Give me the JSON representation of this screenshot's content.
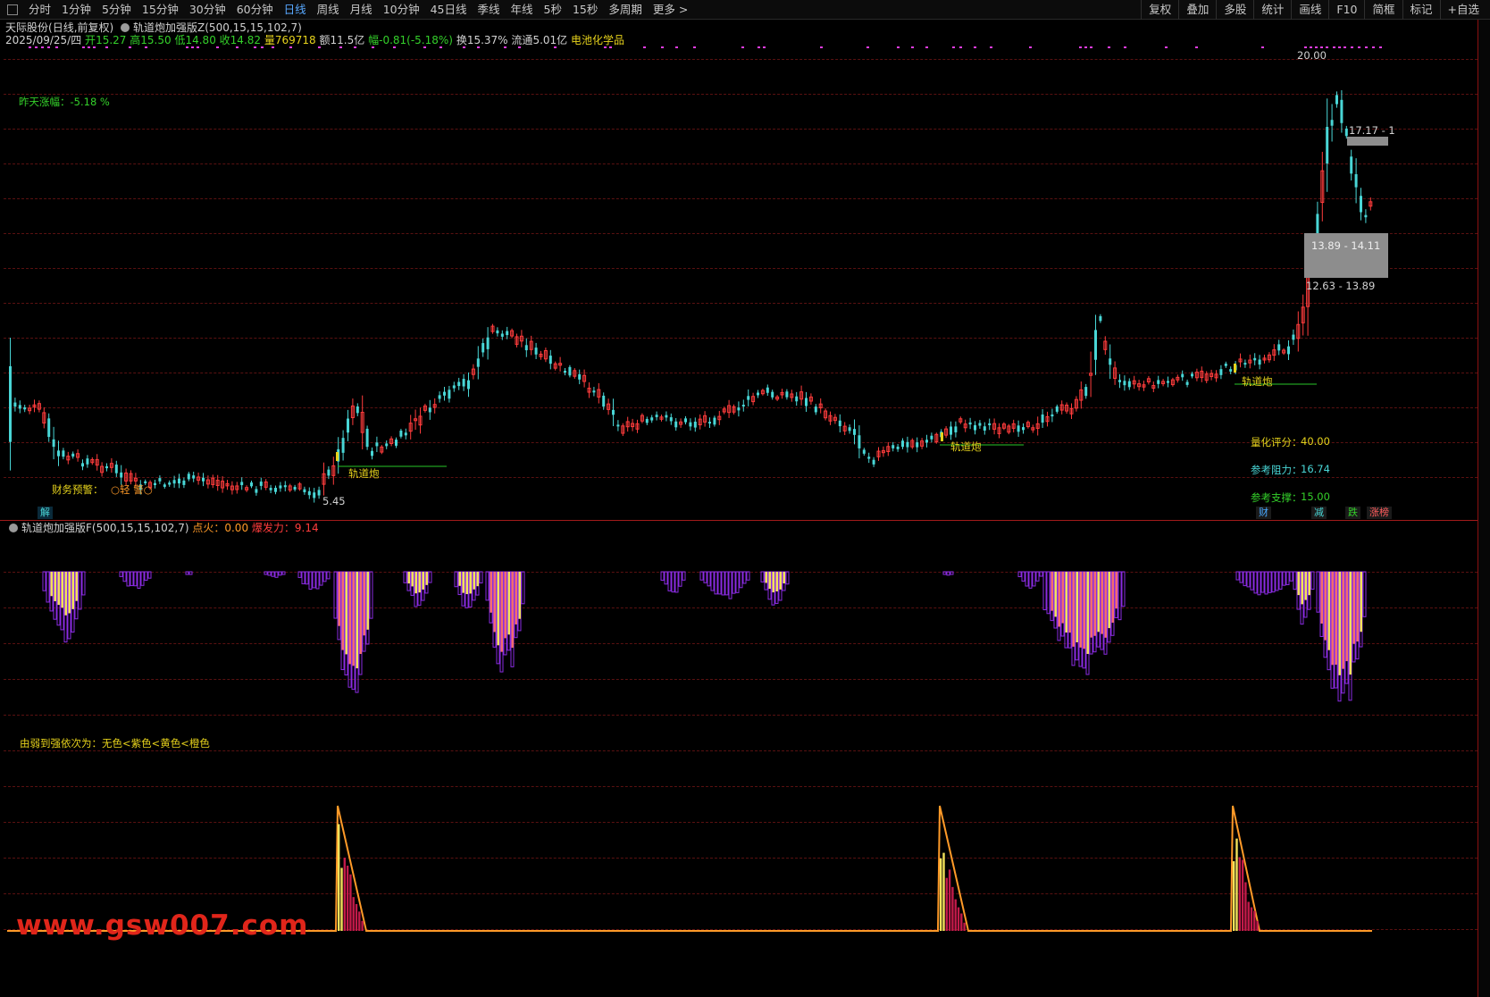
{
  "toolbar": {
    "left": [
      "分时",
      "1分钟",
      "5分钟",
      "15分钟",
      "30分钟",
      "60分钟",
      "日线",
      "周线",
      "月线",
      "10分钟",
      "45日线",
      "季线",
      "年线",
      "5秒",
      "15秒",
      "多周期",
      "更多 >"
    ],
    "active": "日线",
    "right": [
      "复权",
      "叠加",
      "多股",
      "统计",
      "画线",
      "F10",
      "简框",
      "标记",
      "+自选"
    ]
  },
  "header": {
    "stock_name": "天际股份",
    "mode": "(日线,前复权)",
    "indicator_main": "轨道炮加强版Z(500,15,15,102,7)",
    "date": "2025/09/25/四",
    "open_label": "开",
    "open": "15.27",
    "high_label": "高",
    "high": "15.50",
    "low_label": "低",
    "low": "14.80",
    "close_label": "收",
    "close": "14.82",
    "vol_label": "量",
    "vol": "769718",
    "amount_label": "额",
    "amount": "11.5亿",
    "change_label": "幅",
    "change": "-0.81(-5.18%)",
    "turnover_label": "换",
    "turnover": "15.37%",
    "float_label": "流通",
    "float": "5.01亿",
    "sector": "电池化学品"
  },
  "main_chart": {
    "yesterday_change": "昨天涨幅：-5.18 %",
    "finance_warning_label": "财务预警：",
    "finance_warning_value": "○轻 警○",
    "low_marker": "5.45",
    "high_marker": "20.00",
    "signal_label": "轨道炮",
    "zone_upper": "17.17 - 1",
    "zone_mid": "13.89 - 14.11",
    "zone_low": "12.63 - 13.89",
    "score_label": "量化评分：",
    "score": "40.00",
    "resistance_label": "参考阻力：",
    "resistance": "16.74",
    "support_label": "参考支撑：",
    "support": "15.00",
    "bottom_left_tag": "解",
    "bottom_tags": [
      {
        "text": "财",
        "color": "#49a8ff"
      },
      {
        "text": "减",
        "color": "#49d6d6"
      },
      {
        "text": "跌",
        "color": "#34d02a"
      },
      {
        "text": "涨榜",
        "color": "#ff5c5c"
      }
    ]
  },
  "sub_chart": {
    "title": "轨道炮加强版F(500,15,15,102,7)",
    "ignite_label": "点火：",
    "ignite": "0.00",
    "burst_label": "爆发力：",
    "burst": "9.14",
    "legend_note": "由弱到强依次为：无色<紫色<黄色<橙色"
  },
  "colors": {
    "up": "#ff3c3c",
    "down": "#49d6d6",
    "grid": "#5a1111",
    "purple": "#8a2be2",
    "yellow": "#f2e25a",
    "orange": "#f26d6d",
    "signal_line": "#29c629"
  },
  "watermark": "www.gsw007.com"
}
